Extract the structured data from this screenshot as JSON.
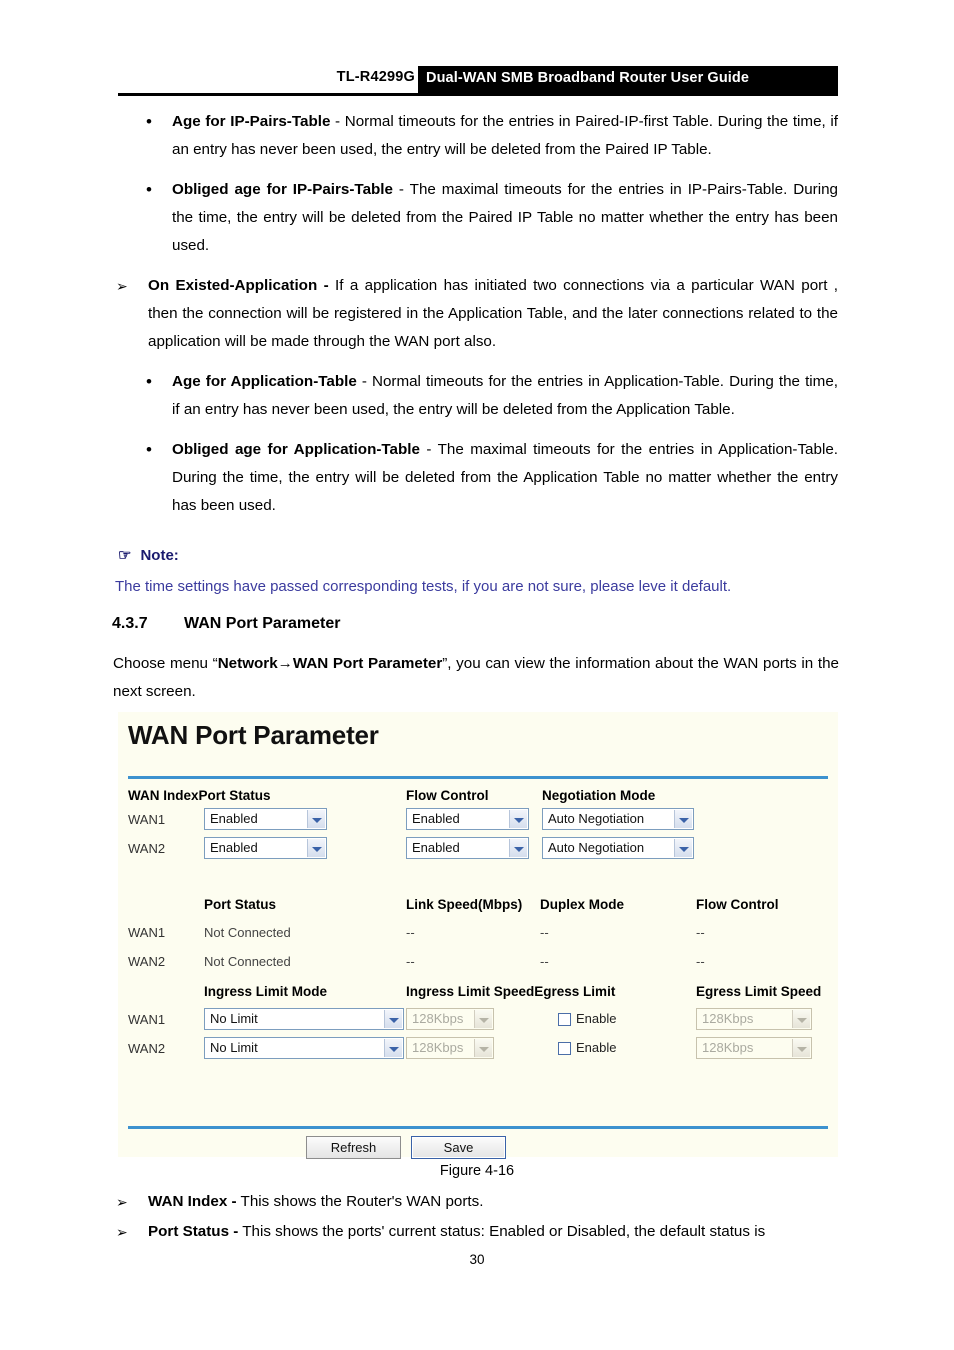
{
  "header": {
    "model": "TL-R4299G",
    "title": "Dual-WAN  SMB  Broadband  Router  User  Guide"
  },
  "bullets": [
    {
      "level": 2,
      "marker": "•",
      "term": "Age for IP-Pairs-Table",
      "text": " - Normal timeouts for the entries in Paired-IP-first Table. During the time, if an entry has never been used, the entry will be deleted from the Paired IP Table."
    },
    {
      "level": 2,
      "marker": "•",
      "term": "Obliged age for IP-Pairs-Table",
      "text": " - The maximal timeouts for the entries in IP-Pairs-Table. During the time, the entry will be deleted from the Paired IP Table no matter whether the entry has been used."
    },
    {
      "level": 1,
      "marker": "➢",
      "term": "On Existed-Application -",
      "text": " If a application has initiated two connections via a particular WAN port , then the connection will be registered in the Application Table, and the later connections related to the application will be made through the WAN port also."
    },
    {
      "level": 2,
      "marker": "•",
      "term": "Age for Application-Table",
      "text": " - Normal timeouts for the entries in Application-Table. During the time, if an entry has never been used, the entry will be deleted from the Application Table."
    },
    {
      "level": 2,
      "marker": "•",
      "term": "Obliged age for Application-Table",
      "text": " - The maximal timeouts for the entries in Application-Table. During the time, the entry will be deleted from the Application Table no matter whether the entry has been used."
    }
  ],
  "note": {
    "hand_icon": "☞",
    "label": "Note:",
    "body": "The time settings have passed corresponding tests, if you are not sure, please leve it default."
  },
  "section": {
    "number": "4.3.7",
    "title": "WAN Port Parameter",
    "intro_pre": "Choose menu “",
    "intro_menu": "Network→WAN Port Parameter",
    "intro_post": "”, you can view the information about the WAN ports in the next screen."
  },
  "ui": {
    "title": "WAN Port Parameter",
    "section1": {
      "headers": [
        "WAN IndexPort Status",
        "Flow Control",
        "Negotiation Mode"
      ],
      "rows": [
        {
          "index": "WAN1",
          "port_status": "Enabled",
          "flow_control": "Enabled",
          "negotiation_mode": "Auto Negotiation"
        },
        {
          "index": "WAN2",
          "port_status": "Enabled",
          "flow_control": "Enabled",
          "negotiation_mode": "Auto Negotiation"
        }
      ]
    },
    "section2": {
      "headers": [
        "Port Status",
        "Link Speed(Mbps)",
        "Duplex Mode",
        "Flow Control"
      ],
      "rows": [
        {
          "index": "WAN1",
          "port_status": "Not Connected",
          "link_speed": "--",
          "duplex_mode": "--",
          "flow_control": "--"
        },
        {
          "index": "WAN2",
          "port_status": "Not Connected",
          "link_speed": "--",
          "duplex_mode": "--",
          "flow_control": "--"
        }
      ]
    },
    "section3": {
      "headers": [
        "Ingress Limit Mode",
        "Ingress Limit SpeedEgress Limit",
        "Egress Limit Speed"
      ],
      "rows": [
        {
          "index": "WAN1",
          "ingress_limit_mode": "No Limit",
          "ingress_limit_speed": "128Kbps",
          "egress_limit_label": "Enable",
          "egress_limit_checked": false,
          "egress_limit_speed": "128Kbps"
        },
        {
          "index": "WAN2",
          "ingress_limit_mode": "No Limit",
          "ingress_limit_speed": "128Kbps",
          "egress_limit_label": "Enable",
          "egress_limit_checked": false,
          "egress_limit_speed": "128Kbps"
        }
      ]
    },
    "buttons": {
      "refresh": "Refresh",
      "save": "Save"
    },
    "colors": {
      "panel_bg": "#fdfdf0",
      "divider": "#3d92cf",
      "select_border": "#7c9dbe"
    }
  },
  "figure_caption": "Figure 4-16",
  "footer_bullets": [
    {
      "marker": "➢",
      "term": "WAN Index -",
      "text": " This shows the Router's WAN ports."
    },
    {
      "marker": "➢",
      "term": "Port Status -",
      "text": " This shows the ports' current status: Enabled or Disabled, the default status is"
    }
  ],
  "page_number": "30"
}
